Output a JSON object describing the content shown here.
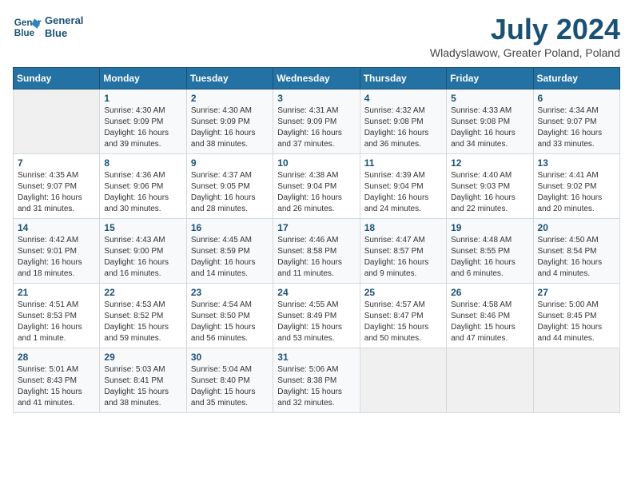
{
  "header": {
    "logo_line1": "General",
    "logo_line2": "Blue",
    "title": "July 2024",
    "subtitle": "Wladyslawow, Greater Poland, Poland"
  },
  "days_of_week": [
    "Sunday",
    "Monday",
    "Tuesday",
    "Wednesday",
    "Thursday",
    "Friday",
    "Saturday"
  ],
  "weeks": [
    [
      {
        "day": "",
        "info": ""
      },
      {
        "day": "1",
        "info": "Sunrise: 4:30 AM\nSunset: 9:09 PM\nDaylight: 16 hours\nand 39 minutes."
      },
      {
        "day": "2",
        "info": "Sunrise: 4:30 AM\nSunset: 9:09 PM\nDaylight: 16 hours\nand 38 minutes."
      },
      {
        "day": "3",
        "info": "Sunrise: 4:31 AM\nSunset: 9:09 PM\nDaylight: 16 hours\nand 37 minutes."
      },
      {
        "day": "4",
        "info": "Sunrise: 4:32 AM\nSunset: 9:08 PM\nDaylight: 16 hours\nand 36 minutes."
      },
      {
        "day": "5",
        "info": "Sunrise: 4:33 AM\nSunset: 9:08 PM\nDaylight: 16 hours\nand 34 minutes."
      },
      {
        "day": "6",
        "info": "Sunrise: 4:34 AM\nSunset: 9:07 PM\nDaylight: 16 hours\nand 33 minutes."
      }
    ],
    [
      {
        "day": "7",
        "info": "Sunrise: 4:35 AM\nSunset: 9:07 PM\nDaylight: 16 hours\nand 31 minutes."
      },
      {
        "day": "8",
        "info": "Sunrise: 4:36 AM\nSunset: 9:06 PM\nDaylight: 16 hours\nand 30 minutes."
      },
      {
        "day": "9",
        "info": "Sunrise: 4:37 AM\nSunset: 9:05 PM\nDaylight: 16 hours\nand 28 minutes."
      },
      {
        "day": "10",
        "info": "Sunrise: 4:38 AM\nSunset: 9:04 PM\nDaylight: 16 hours\nand 26 minutes."
      },
      {
        "day": "11",
        "info": "Sunrise: 4:39 AM\nSunset: 9:04 PM\nDaylight: 16 hours\nand 24 minutes."
      },
      {
        "day": "12",
        "info": "Sunrise: 4:40 AM\nSunset: 9:03 PM\nDaylight: 16 hours\nand 22 minutes."
      },
      {
        "day": "13",
        "info": "Sunrise: 4:41 AM\nSunset: 9:02 PM\nDaylight: 16 hours\nand 20 minutes."
      }
    ],
    [
      {
        "day": "14",
        "info": "Sunrise: 4:42 AM\nSunset: 9:01 PM\nDaylight: 16 hours\nand 18 minutes."
      },
      {
        "day": "15",
        "info": "Sunrise: 4:43 AM\nSunset: 9:00 PM\nDaylight: 16 hours\nand 16 minutes."
      },
      {
        "day": "16",
        "info": "Sunrise: 4:45 AM\nSunset: 8:59 PM\nDaylight: 16 hours\nand 14 minutes."
      },
      {
        "day": "17",
        "info": "Sunrise: 4:46 AM\nSunset: 8:58 PM\nDaylight: 16 hours\nand 11 minutes."
      },
      {
        "day": "18",
        "info": "Sunrise: 4:47 AM\nSunset: 8:57 PM\nDaylight: 16 hours\nand 9 minutes."
      },
      {
        "day": "19",
        "info": "Sunrise: 4:48 AM\nSunset: 8:55 PM\nDaylight: 16 hours\nand 6 minutes."
      },
      {
        "day": "20",
        "info": "Sunrise: 4:50 AM\nSunset: 8:54 PM\nDaylight: 16 hours\nand 4 minutes."
      }
    ],
    [
      {
        "day": "21",
        "info": "Sunrise: 4:51 AM\nSunset: 8:53 PM\nDaylight: 16 hours\nand 1 minute."
      },
      {
        "day": "22",
        "info": "Sunrise: 4:53 AM\nSunset: 8:52 PM\nDaylight: 15 hours\nand 59 minutes."
      },
      {
        "day": "23",
        "info": "Sunrise: 4:54 AM\nSunset: 8:50 PM\nDaylight: 15 hours\nand 56 minutes."
      },
      {
        "day": "24",
        "info": "Sunrise: 4:55 AM\nSunset: 8:49 PM\nDaylight: 15 hours\nand 53 minutes."
      },
      {
        "day": "25",
        "info": "Sunrise: 4:57 AM\nSunset: 8:47 PM\nDaylight: 15 hours\nand 50 minutes."
      },
      {
        "day": "26",
        "info": "Sunrise: 4:58 AM\nSunset: 8:46 PM\nDaylight: 15 hours\nand 47 minutes."
      },
      {
        "day": "27",
        "info": "Sunrise: 5:00 AM\nSunset: 8:45 PM\nDaylight: 15 hours\nand 44 minutes."
      }
    ],
    [
      {
        "day": "28",
        "info": "Sunrise: 5:01 AM\nSunset: 8:43 PM\nDaylight: 15 hours\nand 41 minutes."
      },
      {
        "day": "29",
        "info": "Sunrise: 5:03 AM\nSunset: 8:41 PM\nDaylight: 15 hours\nand 38 minutes."
      },
      {
        "day": "30",
        "info": "Sunrise: 5:04 AM\nSunset: 8:40 PM\nDaylight: 15 hours\nand 35 minutes."
      },
      {
        "day": "31",
        "info": "Sunrise: 5:06 AM\nSunset: 8:38 PM\nDaylight: 15 hours\nand 32 minutes."
      },
      {
        "day": "",
        "info": ""
      },
      {
        "day": "",
        "info": ""
      },
      {
        "day": "",
        "info": ""
      }
    ]
  ]
}
